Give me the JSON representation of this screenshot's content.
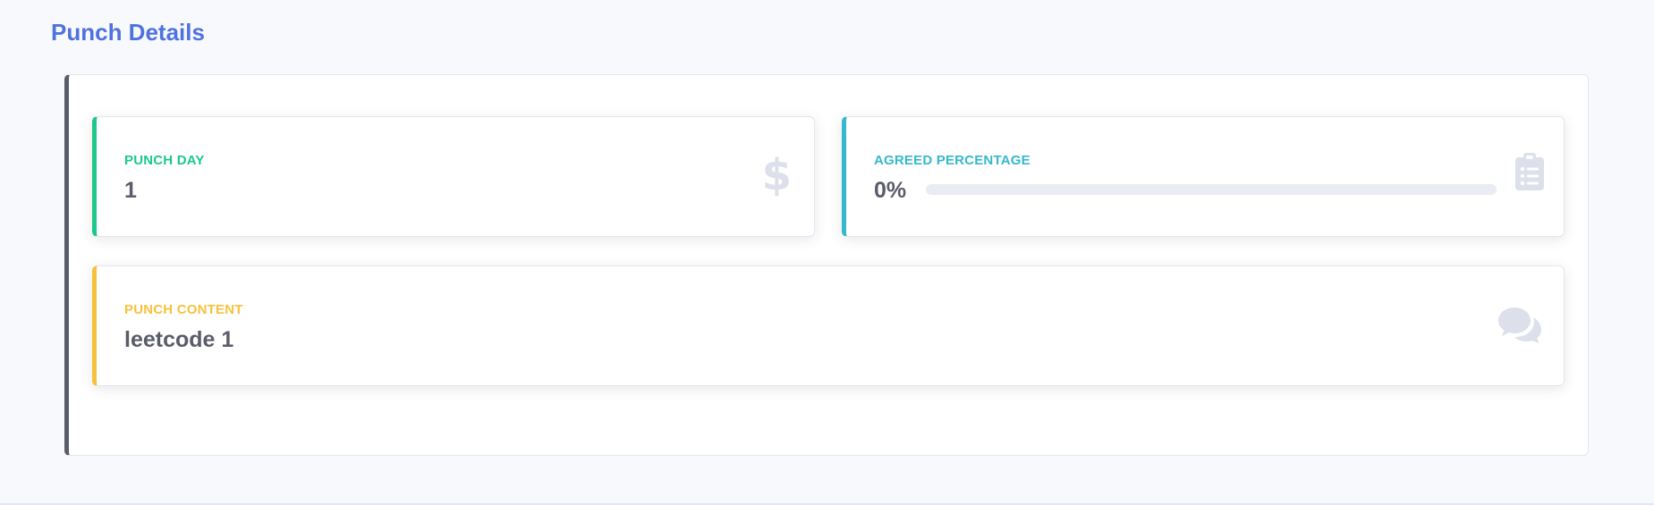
{
  "page": {
    "title": "Punch Details"
  },
  "cards": {
    "punch_day": {
      "label": "PUNCH DAY",
      "value": "1",
      "icon": "dollar-sign-icon",
      "accent": "#1cc88a"
    },
    "agreed_percentage": {
      "label": "AGREED PERCENTAGE",
      "value": "0%",
      "progress": 0,
      "icon": "clipboard-list-icon",
      "accent": "#36b9cc"
    },
    "punch_content": {
      "label": "PUNCH CONTENT",
      "value": "leetcode 1",
      "icon": "comments-icon",
      "accent": "#f6c23e"
    }
  },
  "colors": {
    "title": "#4e73df",
    "panel_border": "#5a5c69",
    "text": "#5a5c69",
    "icon": "#dddfeb",
    "background": "#f8f9fc"
  }
}
